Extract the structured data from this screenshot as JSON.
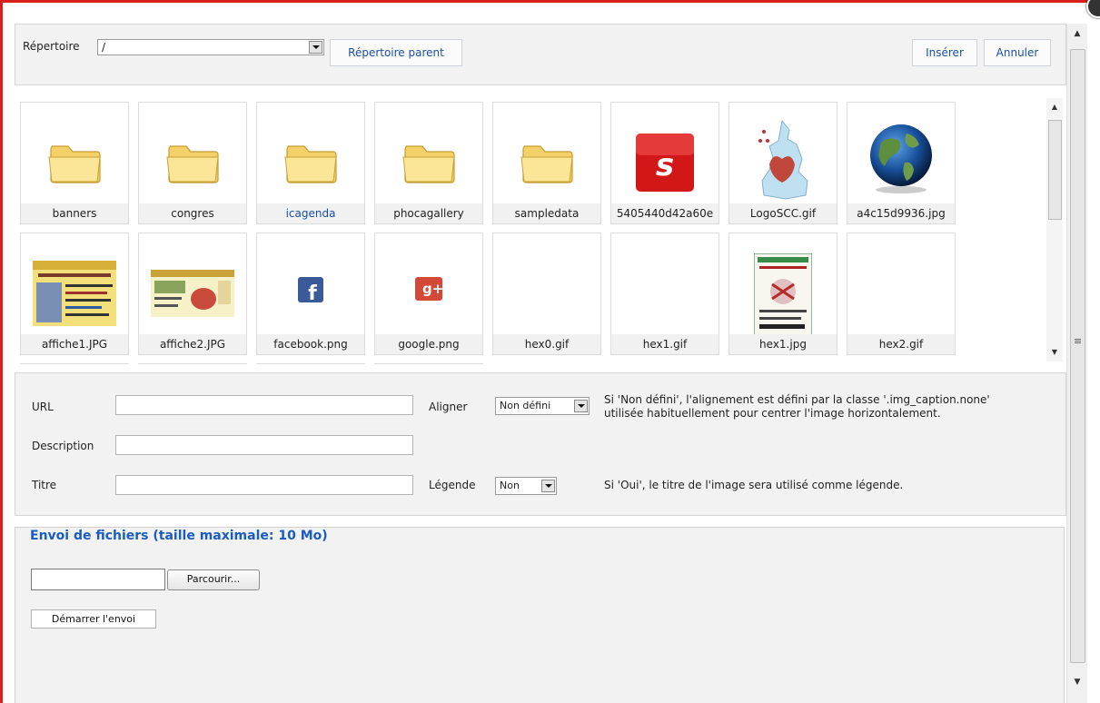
{
  "toolbar": {
    "directory_label": "Répertoire",
    "directory_value": "/",
    "parent_button": "Répertoire parent",
    "insert_button": "Insérer",
    "cancel_button": "Annuler"
  },
  "items": [
    {
      "name": "banners",
      "type": "folder"
    },
    {
      "name": "congres",
      "type": "folder"
    },
    {
      "name": "icagenda",
      "type": "folder",
      "highlight": true
    },
    {
      "name": "phocagallery",
      "type": "folder"
    },
    {
      "name": "sampledata",
      "type": "folder"
    },
    {
      "name": "5405440d42a60e",
      "type": "image-red-s"
    },
    {
      "name": "LogoSCC.gif",
      "type": "image-map"
    },
    {
      "name": "a4c15d9936.jpg",
      "type": "image-globe"
    },
    {
      "name": "affiche1.JPG",
      "type": "image-poster"
    },
    {
      "name": "affiche2.JPG",
      "type": "image-poster2"
    },
    {
      "name": "facebook.png",
      "type": "image-facebook"
    },
    {
      "name": "google.png",
      "type": "image-google"
    },
    {
      "name": "hex0.gif",
      "type": "image-blank"
    },
    {
      "name": "hex1.gif",
      "type": "image-blank"
    },
    {
      "name": "hex1.jpg",
      "type": "image-poster3"
    },
    {
      "name": "hex2.gif",
      "type": "image-blank"
    }
  ],
  "form": {
    "url_label": "URL",
    "description_label": "Description",
    "title_label": "Titre",
    "align_label": "Aligner",
    "align_value": "Non défini",
    "align_info_line1": "Si 'Non défini', l'alignement est défini par la classe '.img_caption.none'",
    "align_info_line2": "utilisée habituellement pour centrer l'image horizontalement.",
    "caption_label": "Légende",
    "caption_value": "Non",
    "caption_info": "Si 'Oui', le titre de l'image sera utilisé comme légende."
  },
  "upload": {
    "legend": "Envoi de fichiers (taille maximale: 10 Mo)",
    "browse_button": "Parcourir...",
    "start_button": "Démarrer l'envoi"
  },
  "colors": {
    "frame_border": "#d9201a",
    "link_blue": "#1a4fa3",
    "legend_blue": "#1a5cc2"
  }
}
